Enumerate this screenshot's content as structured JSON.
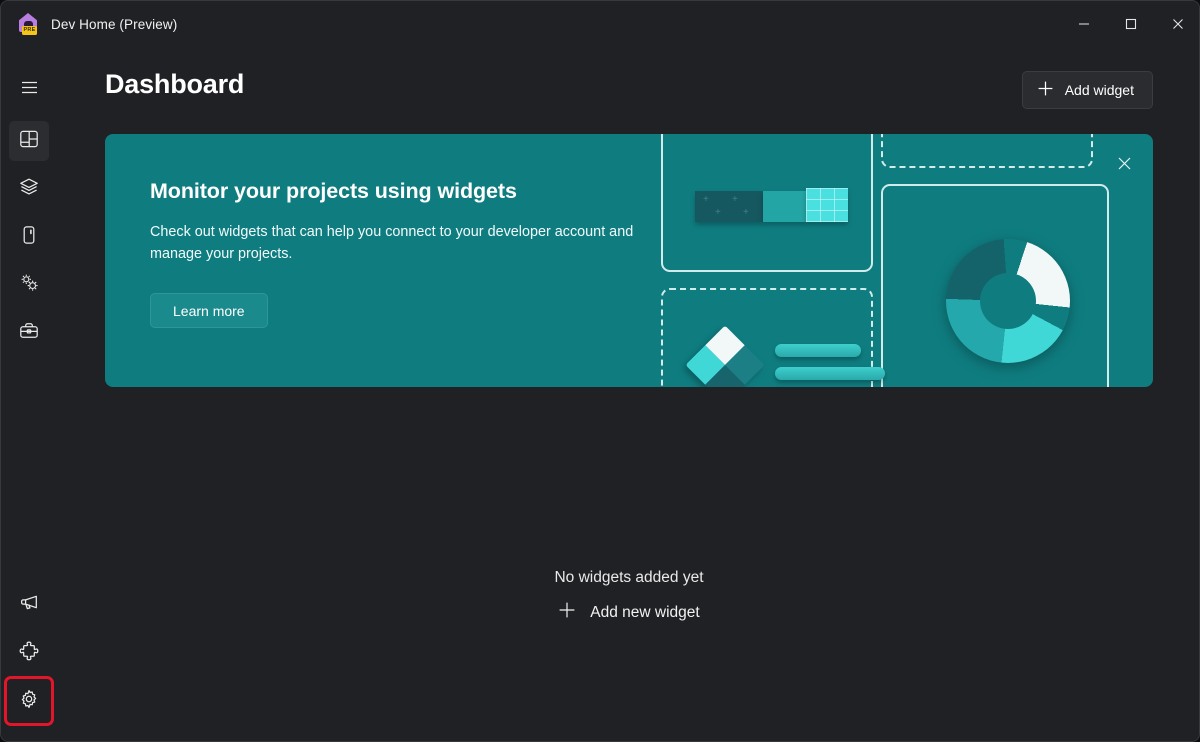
{
  "window": {
    "title": "Dev Home (Preview)",
    "logo_badge": "PRE",
    "logo_icon": "dev-home-house-logo",
    "controls": {
      "minimize": "minimize-icon",
      "maximize": "maximize-icon",
      "close": "close-icon"
    }
  },
  "sidebar": {
    "hamburger": {
      "label": "Navigation menu",
      "icon": "hamburger-menu-icon"
    },
    "items": [
      {
        "label": "Dashboard",
        "icon": "dashboard-icon",
        "selected": true
      },
      {
        "label": "Machine configuration",
        "icon": "layers-stack-icon",
        "selected": false
      },
      {
        "label": "Environments",
        "icon": "device-icon",
        "selected": false
      },
      {
        "label": "Utilities",
        "icon": "gears-icon",
        "selected": false
      },
      {
        "label": "Toolbox",
        "icon": "toolbox-icon",
        "selected": false
      }
    ],
    "bottom_items": [
      {
        "label": "Feedback",
        "icon": "megaphone-icon",
        "annotated": false
      },
      {
        "label": "Extensions",
        "icon": "puzzle-piece-icon",
        "annotated": false
      },
      {
        "label": "Settings",
        "icon": "gear-icon",
        "annotated": true
      }
    ]
  },
  "header": {
    "title": "Dashboard",
    "add_widget_label": "Add widget",
    "add_widget_icon": "plus-icon"
  },
  "banner": {
    "title": "Monitor your projects using widgets",
    "description": "Check out widgets that can help you connect to your developer account and manage your projects.",
    "learn_more_label": "Learn more",
    "close_icon": "close-icon",
    "illustration": {
      "cards": [
        {
          "name": "widget-card-top-left",
          "border": "solid"
        },
        {
          "name": "widget-card-bottom-left",
          "border": "dashed"
        },
        {
          "name": "widget-card-top-right",
          "border": "dashed"
        },
        {
          "name": "widget-card-bottom-right",
          "border": "solid"
        }
      ],
      "donut_icon": "donut-chart-illustration",
      "diamond_icon": "diamond-illustration",
      "blocks_icon": "blocks-illustration"
    }
  },
  "empty_state": {
    "title": "No widgets added yet",
    "add_new_label": "Add new widget",
    "add_new_icon": "plus-icon"
  },
  "colors": {
    "app_background": "#202124",
    "banner_teal": "#0f7d80",
    "accent_selection": "#7fd3d8",
    "annotation_red": "#e2162a",
    "button_surface": "#2b2c30",
    "learn_more_surface": "#1b8a8c"
  }
}
